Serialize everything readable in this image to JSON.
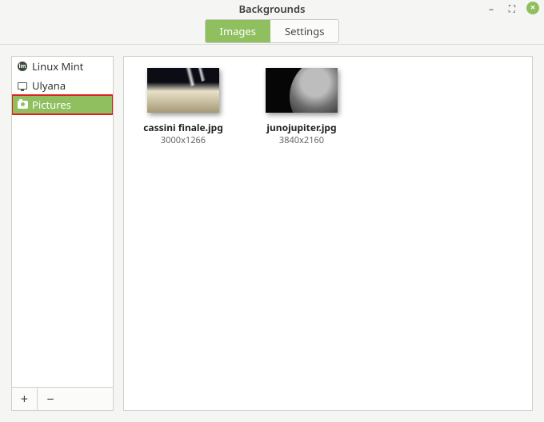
{
  "window": {
    "title": "Backgrounds"
  },
  "tabs": {
    "images": "Images",
    "settings": "Settings"
  },
  "sidebar": {
    "items": [
      {
        "label": "Linux Mint"
      },
      {
        "label": "Ulyana"
      },
      {
        "label": "Pictures"
      }
    ]
  },
  "buttons": {
    "add": "+",
    "remove": "−"
  },
  "images": [
    {
      "name": "cassini finale.jpg",
      "dimensions": "3000x1266"
    },
    {
      "name": "junojupiter.jpg",
      "dimensions": "3840x2160"
    }
  ],
  "win_controls": {
    "minimize": "–",
    "maximize": "⛶",
    "close": "×"
  }
}
